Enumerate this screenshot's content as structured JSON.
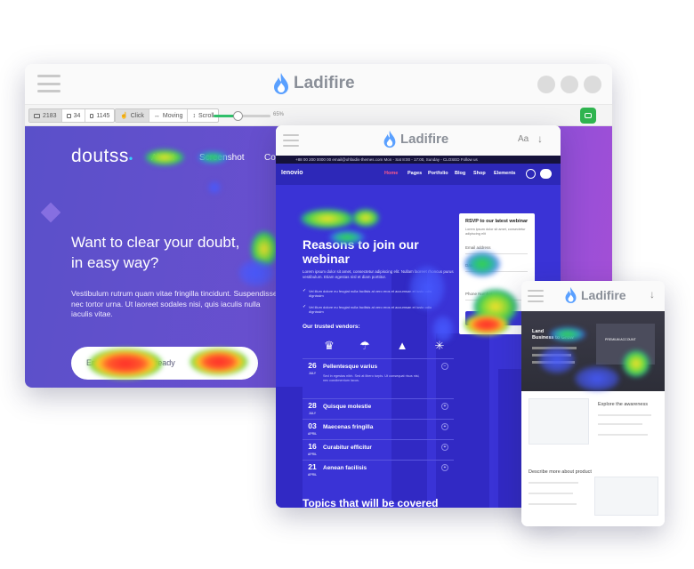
{
  "app": {
    "logo_text": "Ladifire",
    "brand_color": "#5aa0ff"
  },
  "desktop": {
    "toolbar": {
      "devices": [
        {
          "icon": "desktop-icon",
          "count": "2183"
        },
        {
          "icon": "tablet-icon",
          "count": "34"
        },
        {
          "icon": "mobile-icon",
          "count": "1145"
        }
      ],
      "modes": [
        {
          "icon": "click-icon",
          "label": "Click"
        },
        {
          "icon": "moving-icon",
          "label": "Moving"
        },
        {
          "icon": "scroll-icon",
          "label": "Scroll"
        }
      ],
      "opacity_value": "65%",
      "opacity_fraction": 0.3,
      "camera_icon": "camera-icon"
    },
    "site": {
      "brand": "doutss",
      "nav": [
        "About",
        "Screenshot",
        "Co"
      ],
      "hero_title_line1": "Want to clear your doubt,",
      "hero_title_line2": "in easy way?",
      "hero_desc": "Vestibulum rutrum quam vitae fringilla tincidunt. Suspendisse nec tortor urna. Ut laoreet sodales nisi, quis iaculis nulla iaculis vitae.",
      "cta_placeholder": "Email me when it's ready"
    }
  },
  "tablet": {
    "topbar_text": "+88 00 200 0000 00    email@ohfaidis-themes.com    Mon - Sat 8:00 - 17:00, Sunday - CLOSED    Follow us",
    "brand": "Ienovio",
    "nav": [
      "Home",
      "Pages",
      "Portfolio",
      "Blog",
      "Shop",
      "Elements"
    ],
    "hero_title": "Reasons to join our webinar",
    "hero_desc": "Lorem ipsum dolor sit amet, consectetur adipiscing elit. Nullam laoreet rhoncus purus vestibulum. Etiam egestas nisl et diam porttitor.",
    "checks": [
      "Vel illum dolore eu feugiat nulla facilisis at vero eros et accumsan et iusto odio dignissim",
      "Vel illum dolore eu feugiat nulla facilisis at vero eros et accumsan et iusto odio dignissim"
    ],
    "vendors_title": "Our trusted vendors:",
    "rsvp": {
      "title": "RSVP to our latest webinar",
      "subtitle": "Lorem ipsum dolor sit amet, consectetur adipiscing elit",
      "fields": [
        "Email address",
        "Date",
        "Phone Number"
      ]
    },
    "agenda": [
      {
        "day": "26",
        "month": "JULY",
        "title": "Pellentesque varius",
        "body": "Sed in egestas nibh. Sed at libero turpis. Ut consequat risus nisi, nec condimentum lacus."
      },
      {
        "day": "28",
        "month": "JULY",
        "title": "Quisque molestie",
        "body": ""
      },
      {
        "day": "03",
        "month": "APRIL",
        "title": "Maecenas fringilla",
        "body": ""
      },
      {
        "day": "16",
        "month": "APRIL",
        "title": "Curabitur efficitur",
        "body": ""
      },
      {
        "day": "21",
        "month": "APRIL",
        "title": "Aenean facilisis",
        "body": ""
      }
    ],
    "topics_title": "Topics that will be covered"
  },
  "mobile": {
    "hero_title": "Land",
    "hero_title_2": "Business to Grow",
    "section_1": "Explore the awareness",
    "section_2": "Describe more about product",
    "badge": "PREMIUM ACCOUNT"
  }
}
